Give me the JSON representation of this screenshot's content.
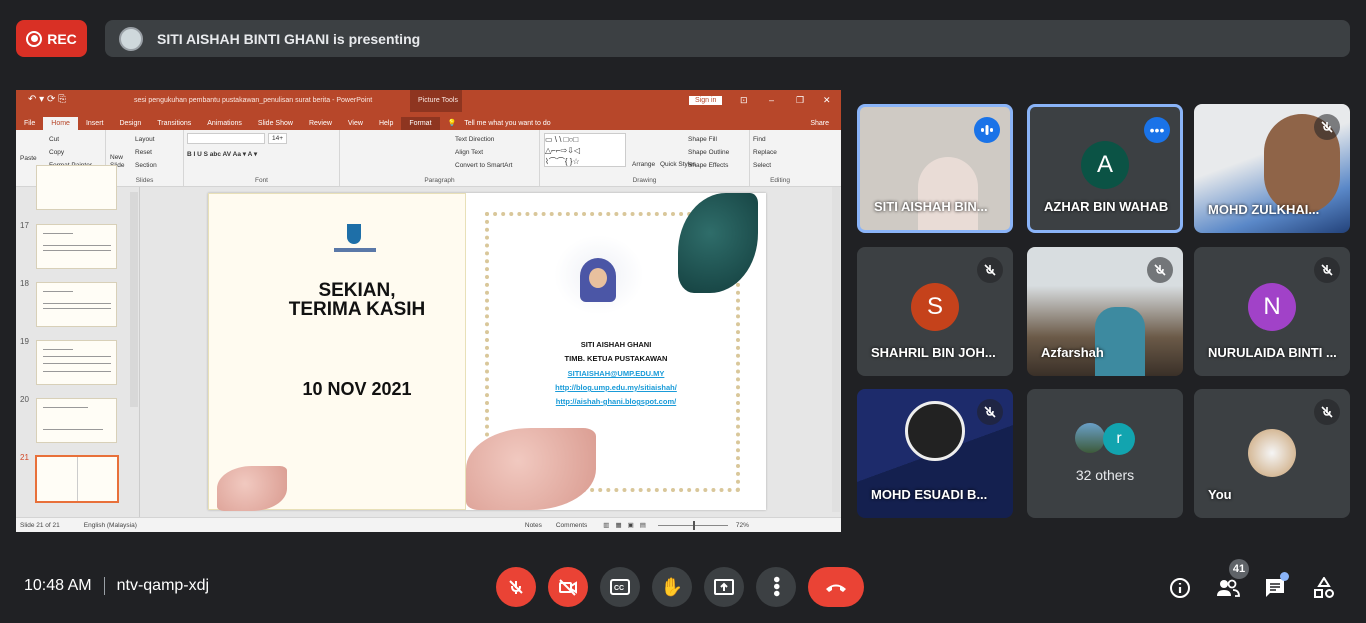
{
  "meeting": {
    "rec_label": "REC",
    "presenting_text": "SITI AISHAH BINTI GHANI is presenting",
    "time": "10:48 AM",
    "code": "ntv-qamp-xdj",
    "participant_count": "41",
    "colors": {
      "background": "#202124",
      "rec": "#d93025",
      "end_call": "#ea4335",
      "active_speaker": "#8ab4f8"
    }
  },
  "ppt": {
    "title": "sesi pengukuhan pembantu pustakawan_penulisan surat berita  -  PowerPoint",
    "picture_tools": "Picture Tools",
    "sign_in": "Sign in",
    "tabs": [
      "File",
      "Home",
      "Insert",
      "Design",
      "Transitions",
      "Animations",
      "Slide Show",
      "Review",
      "View",
      "Help",
      "Format"
    ],
    "tell_me": "Tell me what you want to do",
    "share": "Share",
    "ribbon": {
      "clipboard": {
        "label": "Clipboard",
        "paste": "Paste",
        "cut": "Cut",
        "copy": "Copy",
        "format_painter": "Format Painter"
      },
      "slides": {
        "label": "Slides",
        "new_slide": "New Slide",
        "layout": "Layout",
        "reset": "Reset",
        "section": "Section"
      },
      "font": {
        "label": "Font",
        "size": "14+"
      },
      "paragraph": {
        "label": "Paragraph",
        "text_direction": "Text Direction",
        "align_text": "Align Text",
        "smartart": "Convert to SmartArt"
      },
      "drawing": {
        "label": "Drawing",
        "arrange": "Arrange",
        "quick_styles": "Quick Styles",
        "shape_fill": "Shape Fill",
        "shape_outline": "Shape Outline",
        "shape_effects": "Shape Effects"
      },
      "editing": {
        "label": "Editing",
        "find": "Find",
        "replace": "Replace",
        "select": "Select"
      }
    },
    "thumbnails": [
      "17",
      "18",
      "19",
      "20",
      "21"
    ],
    "slide": {
      "title_line1": "SEKIAN,",
      "title_line2": "TERIMA KASIH",
      "date": "10 NOV 2021",
      "name": "SITI AISHAH GHANI",
      "position": "TIMB. KETUA PUSTAKAWAN",
      "email": "SITIAISHAH@UMP.EDU.MY",
      "blog1": "http://blog.ump.edu.my/sitiaishah/",
      "blog2": "http://aishah-ghani.blogspot.com/"
    },
    "status": {
      "slide": "Slide 21 of 21",
      "language": "English (Malaysia)",
      "notes": "Notes",
      "comments": "Comments",
      "zoom": "72%"
    }
  },
  "tiles": [
    {
      "name": "SITI AISHAH BIN...",
      "type": "video",
      "state": "speaking"
    },
    {
      "name": "AZHAR BIN WAHAB",
      "initial": "A",
      "color": "#0b5345",
      "state": "more"
    },
    {
      "name": "MOHD ZULKHAI...",
      "type": "video",
      "state": "muted"
    },
    {
      "name": "SHAHRIL BIN JOH...",
      "initial": "S",
      "color": "#c5421b",
      "state": "muted"
    },
    {
      "name": "Azfarshah",
      "type": "video",
      "state": "muted"
    },
    {
      "name": "NURULAIDA BINTI ...",
      "initial": "N",
      "color": "#a142c8",
      "state": "muted"
    },
    {
      "name": "MOHD ESUADI B...",
      "type": "logo",
      "state": "muted"
    },
    {
      "name": "32 others",
      "initial": "r",
      "color": "#12a4af"
    },
    {
      "name": "You",
      "type": "avatar",
      "state": "muted"
    }
  ]
}
